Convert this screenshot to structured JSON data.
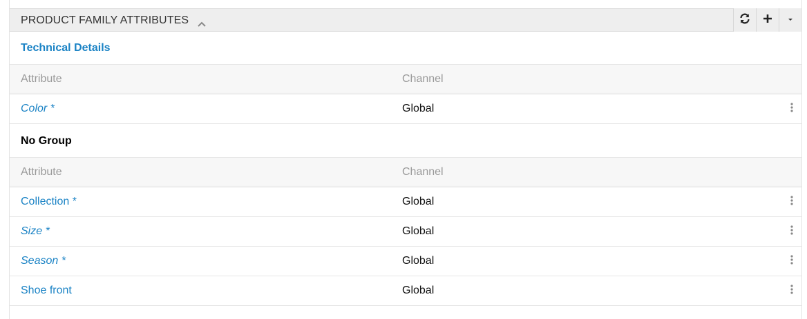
{
  "panel": {
    "title": "PRODUCT FAMILY ATTRIBUTES",
    "toolbar": [
      {
        "name": "refresh",
        "icon": "refresh-icon"
      },
      {
        "name": "add",
        "icon": "plus-icon"
      },
      {
        "name": "more",
        "icon": "caret-down-icon"
      }
    ]
  },
  "groups": [
    {
      "title": "Technical Details",
      "columns": {
        "attribute": "Attribute",
        "channel": "Channel"
      },
      "rows": [
        {
          "attribute": "Color *",
          "channel": "Global",
          "italic": true
        }
      ]
    },
    {
      "title": "No Group",
      "columns": {
        "attribute": "Attribute",
        "channel": "Channel"
      },
      "rows": [
        {
          "attribute": "Collection *",
          "channel": "Global",
          "italic": false
        },
        {
          "attribute": "Size *",
          "channel": "Global",
          "italic": true
        },
        {
          "attribute": "Season *",
          "channel": "Global",
          "italic": true
        },
        {
          "attribute": "Shoe front",
          "channel": "Global",
          "italic": false
        }
      ]
    }
  ],
  "colors": {
    "link": "#1b83c5",
    "header_bg": "#eeeeee",
    "table_header_bg": "#f7f7f7",
    "muted_text": "#999999"
  }
}
